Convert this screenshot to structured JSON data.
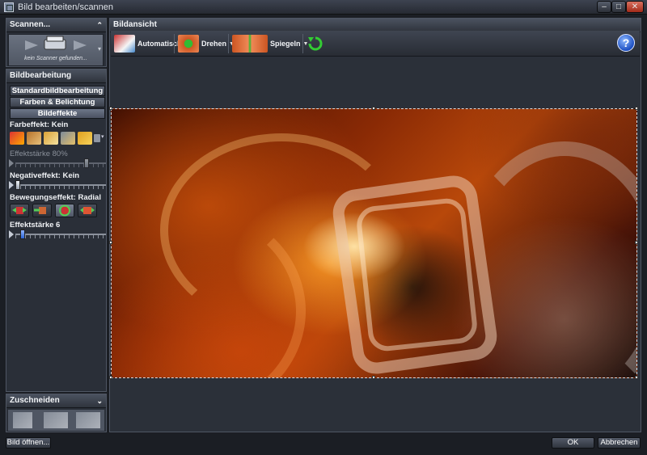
{
  "window": {
    "title": "Bild bearbeiten/scannen",
    "buttons": {
      "minimize": "–",
      "maximize": "□",
      "close": "✕"
    }
  },
  "left": {
    "scan": {
      "title": "Scannen...",
      "status": "kein Scanner gefunden..."
    },
    "edit": {
      "title": "Bildbearbeitung",
      "tabs": [
        "Standardbildbearbeitung",
        "Farben & Belichtung",
        "Bildeffekte"
      ],
      "color_effect_label": "Farbeffekt: Kein",
      "effect_strength_label": "Effektstärke 80%",
      "effect_strength_value": 0.8,
      "negative_label": "Negativeffekt: Kein",
      "negative_value": 0.0,
      "motion_label": "Bewegungseffekt: Radial",
      "motion_strength_label": "Effektstärke 6",
      "motion_strength_value": 0.06
    },
    "crop": {
      "title": "Zuschneiden"
    }
  },
  "view": {
    "title": "Bildansicht",
    "toolbar": {
      "auto": "Automatisch",
      "rotate": "Drehen",
      "mirror": "Spiegeln"
    },
    "help": "?"
  },
  "footer": {
    "open": "Bild öffnen...",
    "ok": "OK",
    "cancel": "Abbrechen"
  },
  "colors": {
    "accent": "#2a63d6",
    "panel": "#2a2f38",
    "background": "#1b1e24"
  }
}
